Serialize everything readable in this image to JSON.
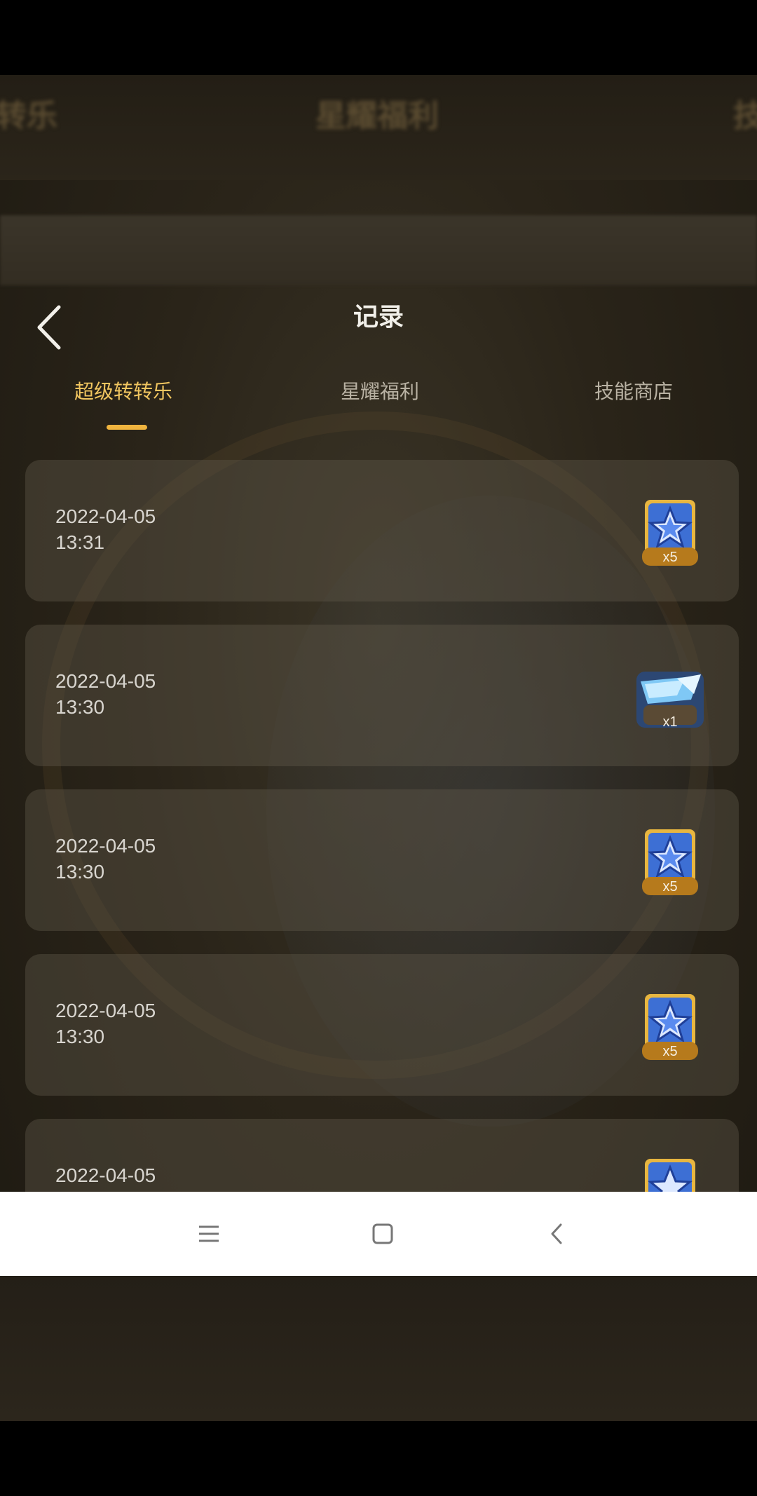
{
  "background": {
    "tabs_blurred": [
      "转乐",
      "星耀福利",
      "技"
    ]
  },
  "header": {
    "back_icon": "chevron-left-icon",
    "title": "记录"
  },
  "tabs": [
    {
      "label": "超级转转乐",
      "active": true
    },
    {
      "label": "星耀福利",
      "active": false
    },
    {
      "label": "技能商店",
      "active": false
    }
  ],
  "records": [
    {
      "date": "2022-04-05",
      "time": "13:31",
      "reward_icon": "star-medal-icon",
      "qty": "x5"
    },
    {
      "date": "2022-04-05",
      "time": "13:30",
      "reward_icon": "crystal-card-icon",
      "qty": "x1"
    },
    {
      "date": "2022-04-05",
      "time": "13:30",
      "reward_icon": "star-medal-icon",
      "qty": "x5"
    },
    {
      "date": "2022-04-05",
      "time": "13:30",
      "reward_icon": "star-medal-icon",
      "qty": "x5"
    },
    {
      "date": "2022-04-05",
      "time": "",
      "reward_icon": "star-medal-icon",
      "qty": ""
    }
  ],
  "navbar": {
    "menu_icon": "menu-icon",
    "home_icon": "home-square-icon",
    "back_icon": "back-chevron-icon"
  },
  "colors": {
    "accent_tab": "#f1c660",
    "indicator": "#f0b43e",
    "navbar_bg": "#ffffff"
  }
}
